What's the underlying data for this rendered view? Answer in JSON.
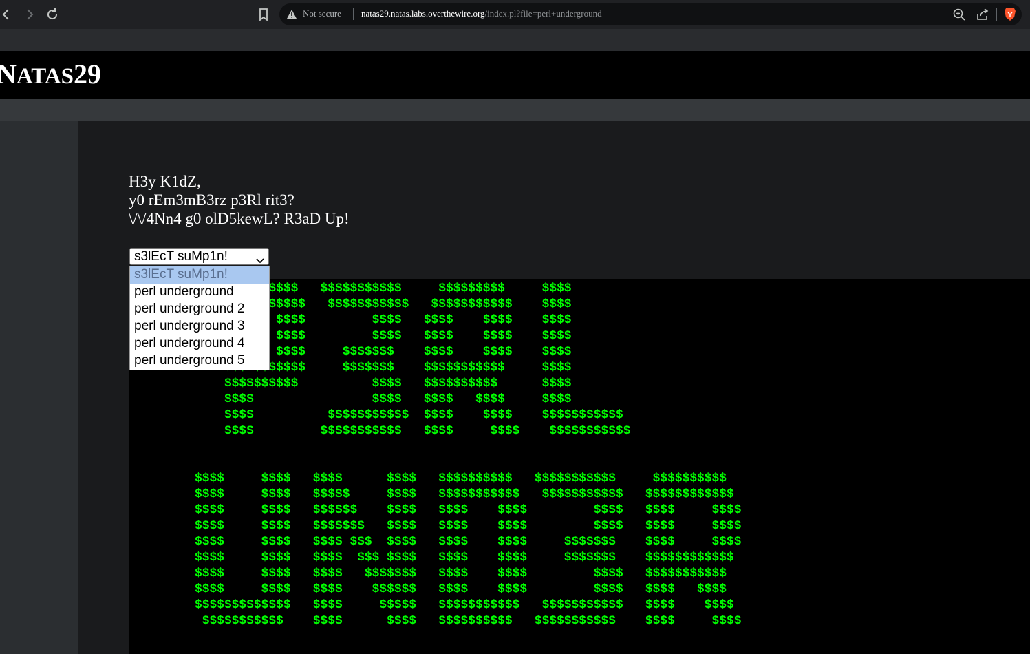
{
  "browser": {
    "security_label": "Not secure",
    "url_host": "natas29.natas.labs.overthewire.org",
    "url_path": "/index.pl?file=perl+underground",
    "icons": [
      "back-icon",
      "forward-icon",
      "reload-icon",
      "bookmark-icon",
      "warning-icon",
      "zoom-icon",
      "share-icon",
      "brave-lion-icon"
    ]
  },
  "header": {
    "title_cap": "N",
    "title_rest": "ATAS",
    "title_num": "29"
  },
  "greeting": {
    "line1": "H3y K1dZ,",
    "line2": "y0 rEm3mB3rz p3Rl rit3?",
    "line3": "\\/\\/4Nn4 g0 olD5kewL? R3aD Up!"
  },
  "select": {
    "current": "s3lEcT suMp1n!",
    "options": [
      "s3lEcT suMp1n!",
      "perl underground",
      "perl underground 2",
      "perl underground 3",
      "perl underground 4",
      "perl underground 5"
    ]
  },
  "art": {
    "text": "                                           \n",
    "color": "#00ff00"
  },
  "colors": {
    "toolbar": "#202124",
    "header_bg": "#000000",
    "content_bg": "#1a1b1d",
    "ascii_green": "#00ff00"
  }
}
